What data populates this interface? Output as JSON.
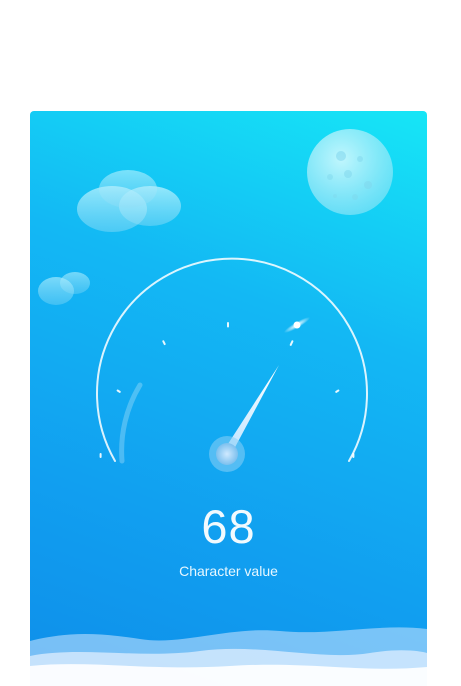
{
  "gauge": {
    "value": "68",
    "value_number": 68,
    "label": "Character value"
  },
  "colors": {
    "gradient_top": "#16e6f6",
    "gradient_bottom": "#0e8ee9",
    "dial": "#ffffff"
  },
  "icons": [
    "cloud-icon",
    "moon-icon",
    "gauge-needle-icon"
  ]
}
